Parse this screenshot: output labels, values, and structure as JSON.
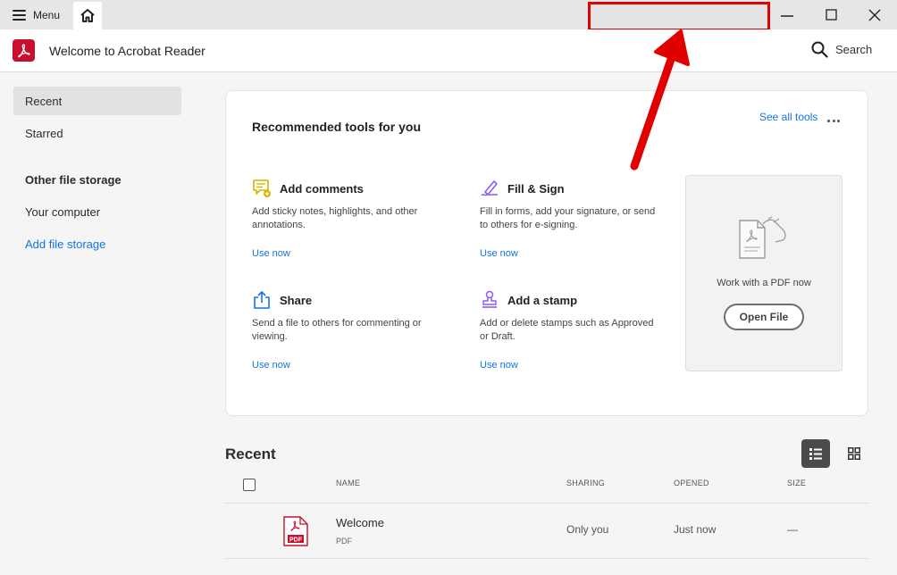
{
  "titlebar": {
    "menu_label": "Menu"
  },
  "header": {
    "title": "Welcome to Acrobat Reader",
    "search_label": "Search"
  },
  "sidebar": {
    "items": [
      {
        "label": "Recent"
      },
      {
        "label": "Starred"
      },
      {
        "label": "Other file storage"
      },
      {
        "label": "Your computer"
      },
      {
        "label": "Add file storage"
      }
    ]
  },
  "recommended": {
    "title": "Recommended tools for you",
    "see_all": "See all tools",
    "tools": [
      {
        "name": "Add comments",
        "desc": "Add sticky notes, highlights, and other annotations.",
        "link": "Use now",
        "icon": "comment-icon"
      },
      {
        "name": "Fill & Sign",
        "desc": "Fill in forms, add your signature, or send to others for e-signing.",
        "link": "Use now",
        "icon": "pen-icon"
      },
      {
        "name": "Share",
        "desc": "Send a file to others for commenting or viewing.",
        "link": "Use now",
        "icon": "share-icon"
      },
      {
        "name": "Add a stamp",
        "desc": "Add or delete stamps such as Approved or Draft.",
        "link": "Use now",
        "icon": "stamp-icon"
      }
    ],
    "drop_text": "Work with a PDF now",
    "open_file": "Open File"
  },
  "recent": {
    "title": "Recent",
    "columns": {
      "name": "NAME",
      "sharing": "SHARING",
      "opened": "OPENED",
      "size": "SIZE"
    },
    "rows": [
      {
        "name": "Welcome",
        "type": "PDF",
        "sharing": "Only you",
        "opened": "Just now",
        "size": "—"
      }
    ]
  },
  "colors": {
    "accent": "#1473e6",
    "brand": "#c8102e",
    "annotation": "#e00000",
    "comment_icon": "#d9b300",
    "sign_icon": "#8b5cf6",
    "share_icon": "#1473e6",
    "stamp_icon": "#8b5cf6"
  }
}
